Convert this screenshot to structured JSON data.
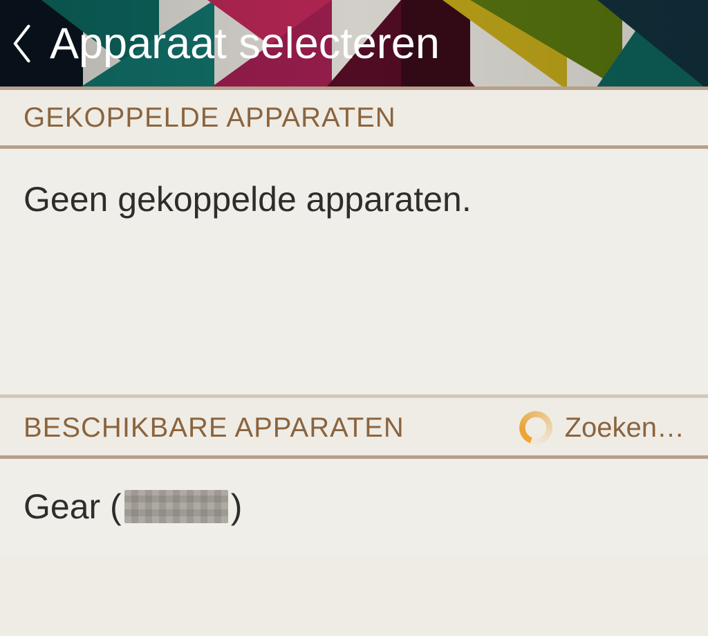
{
  "header": {
    "title": "Apparaat selecteren",
    "back_icon": "chevron-left-icon"
  },
  "sections": {
    "paired": {
      "label": "GEKOPPELDE APPARATEN",
      "empty_text": "Geen gekoppelde apparaten."
    },
    "available": {
      "label": "BESCHIKBARE APPARATEN",
      "searching_label": "Zoeken…",
      "devices": [
        {
          "display_name_prefix": "Gear (",
          "display_name_suffix": ")",
          "name_obscured": true
        }
      ]
    }
  }
}
